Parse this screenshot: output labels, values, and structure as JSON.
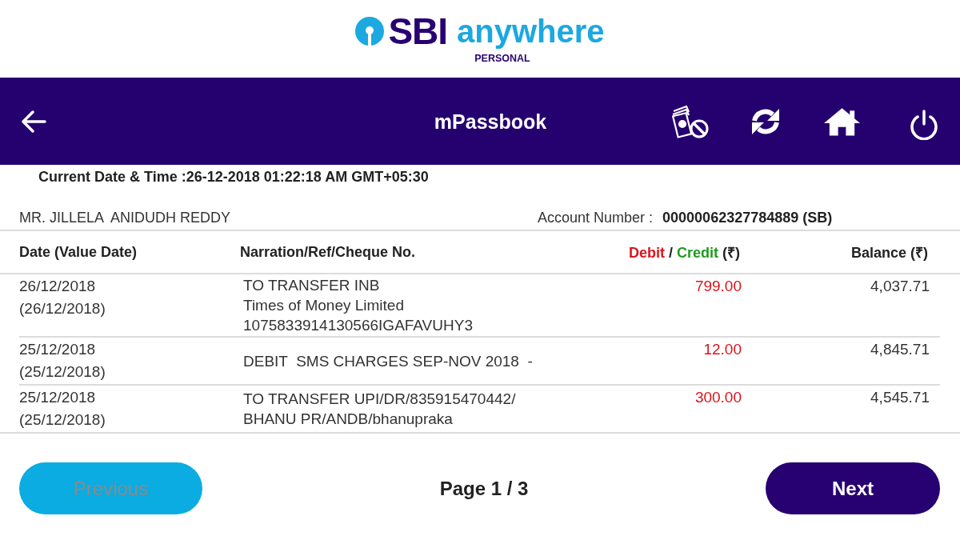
{
  "brand": {
    "name": "SBI",
    "product": "anywhere",
    "edition": "PERSONAL"
  },
  "toolbar": {
    "title": "mPassbook"
  },
  "current_datetime": "Current Date & Time :26-12-2018 01:22:18 AM GMT+05:30",
  "account": {
    "holder": "MR. JILLELA  ANIDUDH REDDY",
    "number_label": "Account Number :",
    "number": "00000062327784889 (SB)"
  },
  "table": {
    "columns": [
      {
        "label": "Date (Value Date)"
      },
      {
        "label": "Narration/Ref/Cheque No."
      },
      {
        "parts": [
          {
            "text": "Debit",
            "kind": "debit"
          },
          {
            "text": "/",
            "kind": "plain"
          },
          {
            "text": "Credit",
            "kind": "credit"
          },
          {
            "text": "(₹)",
            "kind": "plain"
          }
        ]
      },
      {
        "label": "Balance (₹)"
      }
    ],
    "rows": [
      {
        "date": "26/12/2018",
        "value_date": "(26/12/2018)",
        "narration": [
          "TO TRANSFER INB",
          "Times of Money Limited",
          "1075833914130566IGAFAVUHY3"
        ],
        "amount": "799.00",
        "kind": "debit",
        "balance": "4,037.71"
      },
      {
        "date": "25/12/2018",
        "value_date": "(25/12/2018)",
        "narration": [
          "DEBIT  SMS CHARGES SEP-NOV 2018  -"
        ],
        "amount": "12.00",
        "kind": "debit",
        "balance": "4,845.71"
      },
      {
        "date": "25/12/2018",
        "value_date": "(25/12/2018)",
        "narration": [
          "TO TRANSFER UPI/DR/835915470442/",
          "BHANU PR/ANDB/bhanupraka"
        ],
        "amount": "300.00",
        "kind": "debit",
        "balance": "4,545.71"
      }
    ]
  },
  "pager": {
    "previous": {
      "label": "Previous",
      "disabled": true
    },
    "page": "Page 1 / 3",
    "next": {
      "label": "Next",
      "disabled": false
    }
  }
}
